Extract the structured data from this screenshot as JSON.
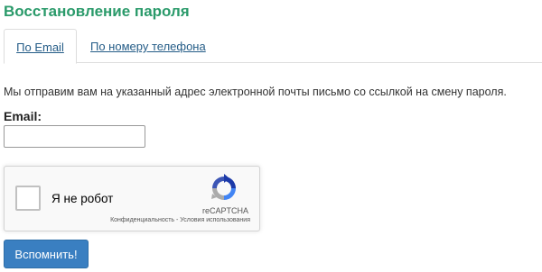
{
  "page": {
    "title": "Восстановление пароля"
  },
  "tabs": [
    {
      "label": "По Email",
      "active": true
    },
    {
      "label": "По номеру телефона",
      "active": false
    }
  ],
  "form": {
    "info_text": "Мы отправим вам на указанный адрес электронной почты письмо со ссылкой на смену пароля.",
    "email_label": "Email:",
    "email_value": "",
    "submit_label": "Вспомнить!"
  },
  "recaptcha": {
    "checkbox_label": "Я не робот",
    "brand": "reCAPTCHA",
    "links": "Конфиденциальность - Условия использования",
    "logo_icon": "recaptcha-logo-icon"
  },
  "colors": {
    "title": "#2a9a6a",
    "link": "#245c87",
    "button": "#3a7fc1"
  }
}
